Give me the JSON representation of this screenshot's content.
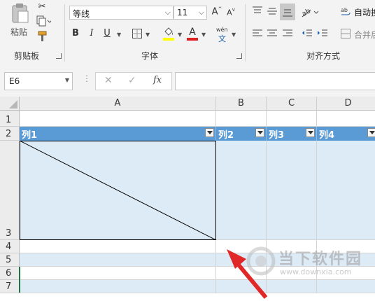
{
  "ribbon": {
    "clipboard": {
      "paste_label": "粘贴",
      "group_label": "剪贴板"
    },
    "font": {
      "font_name": "等线",
      "font_size": "11",
      "grow_label": "A",
      "shrink_label": "A",
      "bold": "B",
      "italic": "I",
      "underline": "U",
      "font_color_label": "A",
      "fill_color": "#ffff00",
      "font_color": "#e02020",
      "phonetic_label": "wén",
      "phonetic_sub": "文",
      "group_label": "字体"
    },
    "alignment": {
      "wrap_label": "自动换",
      "merge_label": "合并后",
      "group_label": "对齐方式"
    }
  },
  "formula_bar": {
    "name_box": "E6",
    "fx_label": "fx",
    "formula": ""
  },
  "grid": {
    "columns": [
      "A",
      "B",
      "C",
      "D"
    ],
    "rows": [
      "1",
      "2",
      "3",
      "4",
      "5",
      "6",
      "7"
    ],
    "table_headers": [
      "列1",
      "列2",
      "列3",
      "列4"
    ],
    "header_color": "#5b9bd5",
    "band_color": "#ddebf7"
  },
  "watermark": {
    "brand": "当下软件园",
    "url": "www.downxia.com"
  }
}
